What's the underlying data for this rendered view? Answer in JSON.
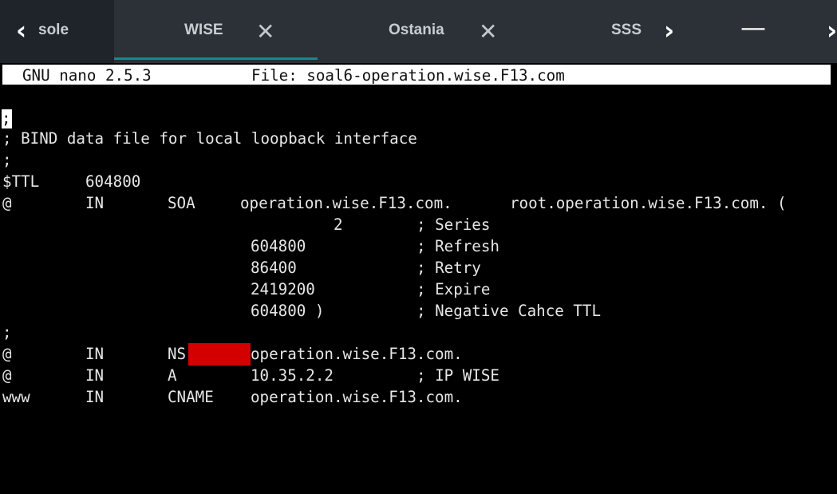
{
  "tabs": [
    {
      "label": "sole",
      "closable": false
    },
    {
      "label": "WISE",
      "closable": true,
      "active": true
    },
    {
      "label": "Ostania",
      "closable": true
    },
    {
      "label": "SSS",
      "closable": false
    }
  ],
  "icons": {
    "nav_left": "‹",
    "nav_right": "›",
    "close": "✕",
    "minimize": "—",
    "overflow_right": "›"
  },
  "editor": {
    "app": "GNU nano 2.5.3",
    "file_label": "File: soal6-operation.wise.F13.com"
  },
  "zone_file": {
    "cursor_char": ";",
    "comment": "; BIND data file for local loopback interface",
    "comment_sep": ";",
    "ttl_key": "$TTL",
    "ttl_value": "604800",
    "soa": {
      "owner": "@",
      "class": "IN",
      "type": "SOA",
      "mname": "operation.wise.F13.com.",
      "rname": "root.operation.wise.F13.com. (",
      "serial": "2",
      "serial_comment": "; Series",
      "refresh": "604800",
      "refresh_comment": "; Refresh",
      "retry": "86400",
      "retry_comment": "; Retry",
      "expire": "2419200",
      "expire_comment": "; Expire",
      "negative": "604800 )",
      "negative_comment": "; Negative Cahce TTL"
    },
    "separator": ";",
    "records": [
      {
        "owner": "@",
        "class": "IN",
        "type": "NS",
        "value": "operation.wise.F13.com.",
        "comment": ""
      },
      {
        "owner": "@",
        "class": "IN",
        "type": "A",
        "value": "10.35.2.2",
        "comment": "; IP WISE"
      },
      {
        "owner": "www",
        "class": "IN",
        "type": "CNAME",
        "value": "operation.wise.F13.com.",
        "comment": ""
      }
    ]
  },
  "colors": {
    "tabbar": "#2b3136",
    "active_underline": "#128c8c",
    "terminal_bg": "#000000",
    "terminal_fg": "#e6e6e6",
    "redaction": "#d40000"
  }
}
